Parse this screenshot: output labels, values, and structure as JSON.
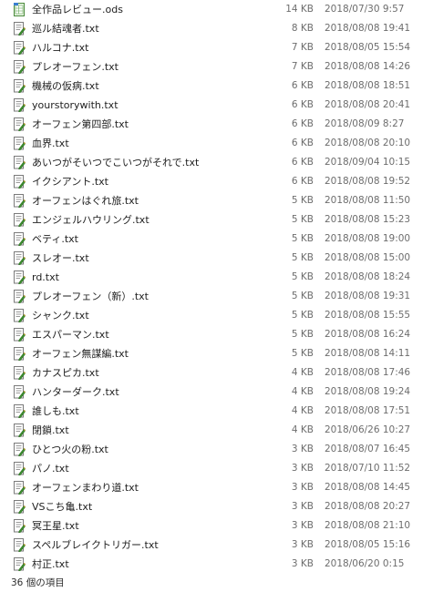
{
  "files": [
    {
      "name": "全作品レビュー.ods",
      "size": "14 KB",
      "date": "2018/07/30 9:57",
      "icon": "spreadsheet-icon"
    },
    {
      "name": "巡ル結魂者.txt",
      "size": "8 KB",
      "date": "2018/08/08 19:41",
      "icon": "text-file-icon"
    },
    {
      "name": "ハルコナ.txt",
      "size": "7 KB",
      "date": "2018/08/05 15:54",
      "icon": "text-file-icon"
    },
    {
      "name": "プレオーフェン.txt",
      "size": "7 KB",
      "date": "2018/08/08 14:26",
      "icon": "text-file-icon"
    },
    {
      "name": "機械の仮病.txt",
      "size": "6 KB",
      "date": "2018/08/08 18:51",
      "icon": "text-file-icon"
    },
    {
      "name": "yourstorywith.txt",
      "size": "6 KB",
      "date": "2018/08/08 20:41",
      "icon": "text-file-icon"
    },
    {
      "name": "オーフェン第四部.txt",
      "size": "6 KB",
      "date": "2018/08/09 8:27",
      "icon": "text-file-icon"
    },
    {
      "name": "血界.txt",
      "size": "6 KB",
      "date": "2018/08/08 20:10",
      "icon": "text-file-icon"
    },
    {
      "name": "あいつがそいつでこいつがそれで.txt",
      "size": "6 KB",
      "date": "2018/09/04 10:15",
      "icon": "text-file-icon"
    },
    {
      "name": "イクシアント.txt",
      "size": "6 KB",
      "date": "2018/08/08 19:52",
      "icon": "text-file-icon"
    },
    {
      "name": "オーフェンはぐれ旅.txt",
      "size": "5 KB",
      "date": "2018/08/08 11:50",
      "icon": "text-file-icon"
    },
    {
      "name": "エンジェルハウリング.txt",
      "size": "5 KB",
      "date": "2018/08/08 15:23",
      "icon": "text-file-icon"
    },
    {
      "name": "ベティ.txt",
      "size": "5 KB",
      "date": "2018/08/08 19:00",
      "icon": "text-file-icon"
    },
    {
      "name": "スレオー.txt",
      "size": "5 KB",
      "date": "2018/08/08 15:00",
      "icon": "text-file-icon"
    },
    {
      "name": "rd.txt",
      "size": "5 KB",
      "date": "2018/08/08 18:24",
      "icon": "text-file-icon"
    },
    {
      "name": "プレオーフェン（新）.txt",
      "size": "5 KB",
      "date": "2018/08/08 19:31",
      "icon": "text-file-icon"
    },
    {
      "name": "シャンク.txt",
      "size": "5 KB",
      "date": "2018/08/08 15:55",
      "icon": "text-file-icon"
    },
    {
      "name": "エスパーマン.txt",
      "size": "5 KB",
      "date": "2018/08/08 16:24",
      "icon": "text-file-icon"
    },
    {
      "name": "オーフェン無謀編.txt",
      "size": "5 KB",
      "date": "2018/08/08 14:11",
      "icon": "text-file-icon"
    },
    {
      "name": "カナスピカ.txt",
      "size": "4 KB",
      "date": "2018/08/08 17:46",
      "icon": "text-file-icon"
    },
    {
      "name": "ハンターダーク.txt",
      "size": "4 KB",
      "date": "2018/08/08 19:24",
      "icon": "text-file-icon"
    },
    {
      "name": "誰しも.txt",
      "size": "4 KB",
      "date": "2018/08/08 17:51",
      "icon": "text-file-icon"
    },
    {
      "name": "閉鎖.txt",
      "size": "4 KB",
      "date": "2018/06/26 10:27",
      "icon": "text-file-icon"
    },
    {
      "name": "ひとつ火の粉.txt",
      "size": "3 KB",
      "date": "2018/08/07 16:45",
      "icon": "text-file-icon"
    },
    {
      "name": "パノ.txt",
      "size": "3 KB",
      "date": "2018/07/10 11:52",
      "icon": "text-file-icon"
    },
    {
      "name": "オーフェンまわり道.txt",
      "size": "3 KB",
      "date": "2018/08/08 14:45",
      "icon": "text-file-icon"
    },
    {
      "name": "VSこち亀.txt",
      "size": "3 KB",
      "date": "2018/08/08 20:27",
      "icon": "text-file-icon"
    },
    {
      "name": "冥王星.txt",
      "size": "3 KB",
      "date": "2018/08/08 21:10",
      "icon": "text-file-icon"
    },
    {
      "name": "スペルブレイクトリガー.txt",
      "size": "3 KB",
      "date": "2018/08/05 15:16",
      "icon": "text-file-icon"
    },
    {
      "name": "村正.txt",
      "size": "3 KB",
      "date": "2018/06/20 0:15",
      "icon": "text-file-icon"
    }
  ],
  "status": {
    "item_count": "36 個の項目"
  }
}
